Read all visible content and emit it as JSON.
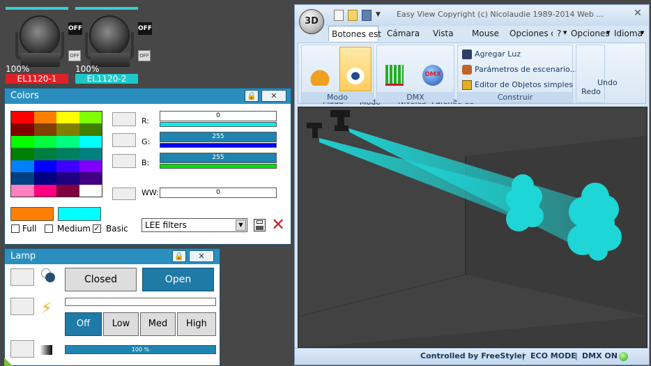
{
  "fixtures": [
    {
      "name": "EL1120-1",
      "percent": "100%",
      "off_big": "OFF",
      "off_small": "OFF",
      "name_color": "#e02027"
    },
    {
      "name": "EL1120-2",
      "percent": "100%",
      "off_big": "OFF",
      "off_small": "OFF",
      "name_color": "#1ec8c8"
    }
  ],
  "colors_panel": {
    "title": "Colors",
    "palette": [
      [
        "#ff0000",
        "#ff8000",
        "#ffff00",
        "#80ff00"
      ],
      [
        "#800000",
        "#804000",
        "#808000",
        "#408000"
      ],
      [
        "#00ff00",
        "#00ff40",
        "#00ff80",
        "#00ffff"
      ],
      [
        "#008000",
        "#008040",
        "#008060",
        "#008080"
      ],
      [
        "#0080ff",
        "#0000ff",
        "#4000ff",
        "#8000ff"
      ],
      [
        "#004080",
        "#000080",
        "#200080",
        "#400080"
      ],
      [
        "#ff80c0",
        "#ff0080",
        "#800040",
        "#ffffff"
      ]
    ],
    "current_color_1": "#ff8000",
    "current_color_2": "#00ffff",
    "channels": [
      {
        "label": "R:",
        "value": "0",
        "fill": false,
        "bar_color": "#00f0f0"
      },
      {
        "label": "G:",
        "value": "255",
        "fill": true,
        "bar_color": "#0000ee"
      },
      {
        "label": "B:",
        "value": "255",
        "fill": true,
        "bar_color": "#00e000"
      },
      {
        "label": "WW:",
        "value": "0",
        "fill": false,
        "bar_color": ""
      }
    ],
    "checkboxes": [
      {
        "label": "Full",
        "checked": false
      },
      {
        "label": "Medium",
        "checked": false
      },
      {
        "label": "Basic",
        "checked": true
      }
    ],
    "filter_select": "LEE filters"
  },
  "lamp_panel": {
    "title": "Lamp",
    "closed_label": "Closed",
    "open_label": "Open",
    "modes": [
      "Off",
      "Low",
      "Med",
      "High"
    ],
    "active_mode": "Off",
    "dimmer": "100 %",
    "dimmer_fraction": 1.0
  },
  "window": {
    "logo": "3D",
    "title": "Easy View   Copyright (c) Nicolaudie 1989-2014   Web ...",
    "close": "✕",
    "tabs": [
      "Botones est",
      "Cámara",
      "Vista",
      "Mouse",
      "Opciones d",
      "?",
      "Opciones",
      "Idioma"
    ],
    "groups": {
      "modo": {
        "label": "Modo",
        "construir": "Modo\nConstruir",
        "usuario": "Modo\nusuario"
      },
      "dmx": {
        "label": "DMX",
        "niveles": "Niveles\nDMX",
        "parcheo": "Parcheo de\nUniversos"
      },
      "construir": {
        "label": "Construir",
        "items": [
          "Agregar Luz",
          "Parámetros de escenario...",
          "Editor de Objetos simples"
        ]
      },
      "undo": {
        "label": "Undo\nRedo"
      }
    },
    "status": {
      "controlled": "Controlled by FreeStyler",
      "eco": "ECO MODE",
      "dmx": "DMX ON"
    },
    "beam_color": "#1ed6d6"
  }
}
